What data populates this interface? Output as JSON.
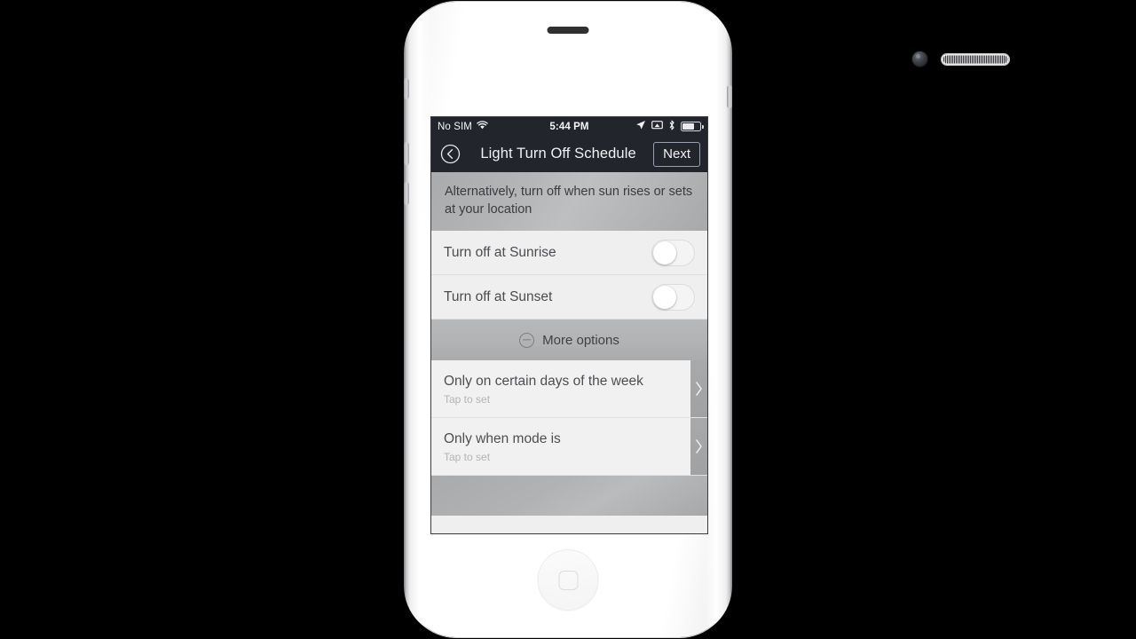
{
  "device": {
    "name": "iphone-4s-white",
    "hardware": {
      "speaker": "top-speaker-slot",
      "camera": "front-camera",
      "earpiece": "earpiece-grille",
      "home_button": "home-button"
    }
  },
  "status_bar": {
    "carrier": "No SIM",
    "wifi_icon": "wifi-icon",
    "time": "5:44 PM",
    "icons": [
      "location-arrow-icon",
      "airplay-icon",
      "bluetooth-icon",
      "battery-icon"
    ],
    "battery_level_percent": 62
  },
  "nav_bar": {
    "back_icon": "back-chevron-circle-icon",
    "title": "Light Turn Off Schedule",
    "next_label": "Next"
  },
  "instruction": {
    "text": "Alternatively, turn off when sun rises or sets at your location"
  },
  "toggles": [
    {
      "label": "Turn off at Sunrise",
      "state": "off"
    },
    {
      "label": "Turn off at Sunset",
      "state": "off"
    }
  ],
  "more_options": {
    "icon": "minus-circle-icon",
    "label": "More options",
    "expanded": true
  },
  "options": [
    {
      "title": "Only on certain days of the week",
      "subtitle": "Tap to set",
      "arrow": "chevron-right-icon"
    },
    {
      "title": "Only when mode is",
      "subtitle": "Tap to set",
      "arrow": "chevron-right-icon"
    }
  ],
  "colors": {
    "nav_background": "#23252d",
    "screen_background": "#efefef",
    "instruction_background": "#b2b4b6",
    "row_background": "#f1f1f2",
    "primary_text": "#4c4e52",
    "muted_text": "#b3b4b6",
    "arrow_strip": "#a3a5a7"
  }
}
